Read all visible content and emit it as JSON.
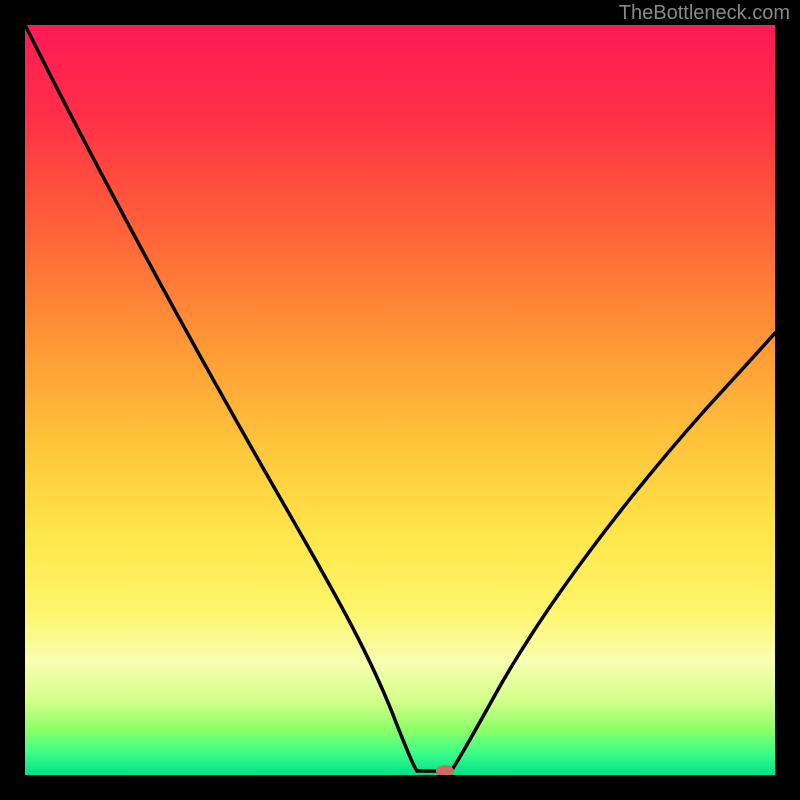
{
  "watermark": "TheBottleneck.com",
  "chart_data": {
    "type": "line",
    "title": "",
    "xlabel": "",
    "ylabel": "",
    "xlim": [
      0,
      100
    ],
    "ylim": [
      0,
      100
    ],
    "background_gradient": [
      {
        "stop": 0.0,
        "color": "#ff1744"
      },
      {
        "stop": 0.15,
        "color": "#ff3d3d"
      },
      {
        "stop": 0.35,
        "color": "#ff8a3d"
      },
      {
        "stop": 0.55,
        "color": "#ffd740"
      },
      {
        "stop": 0.7,
        "color": "#ffeb3b"
      },
      {
        "stop": 0.82,
        "color": "#f9fbe7"
      },
      {
        "stop": 0.88,
        "color": "#eaff8f"
      },
      {
        "stop": 0.95,
        "color": "#76ff03"
      },
      {
        "stop": 1.0,
        "color": "#00e676"
      }
    ],
    "curve_left": [
      {
        "x": 0,
        "y": 100
      },
      {
        "x": 5,
        "y": 90
      },
      {
        "x": 10,
        "y": 80
      },
      {
        "x": 15,
        "y": 70
      },
      {
        "x": 20,
        "y": 61
      },
      {
        "x": 25,
        "y": 52
      },
      {
        "x": 30,
        "y": 44
      },
      {
        "x": 35,
        "y": 36
      },
      {
        "x": 40,
        "y": 28
      },
      {
        "x": 45,
        "y": 20
      },
      {
        "x": 48,
        "y": 13
      },
      {
        "x": 50,
        "y": 6
      },
      {
        "x": 51,
        "y": 1
      },
      {
        "x": 52,
        "y": 0.5
      }
    ],
    "curve_right": [
      {
        "x": 57,
        "y": 0.5
      },
      {
        "x": 58,
        "y": 2
      },
      {
        "x": 60,
        "y": 6
      },
      {
        "x": 65,
        "y": 15
      },
      {
        "x": 70,
        "y": 23
      },
      {
        "x": 75,
        "y": 30
      },
      {
        "x": 80,
        "y": 37
      },
      {
        "x": 85,
        "y": 43
      },
      {
        "x": 90,
        "y": 49
      },
      {
        "x": 95,
        "y": 54
      },
      {
        "x": 100,
        "y": 59
      }
    ],
    "flat_bottom": [
      {
        "x": 52,
        "y": 0.5
      },
      {
        "x": 57,
        "y": 0.5
      }
    ],
    "marker": {
      "x": 56,
      "y": 0.5,
      "color": "#d9736a",
      "rx": 8,
      "ry": 5
    }
  }
}
